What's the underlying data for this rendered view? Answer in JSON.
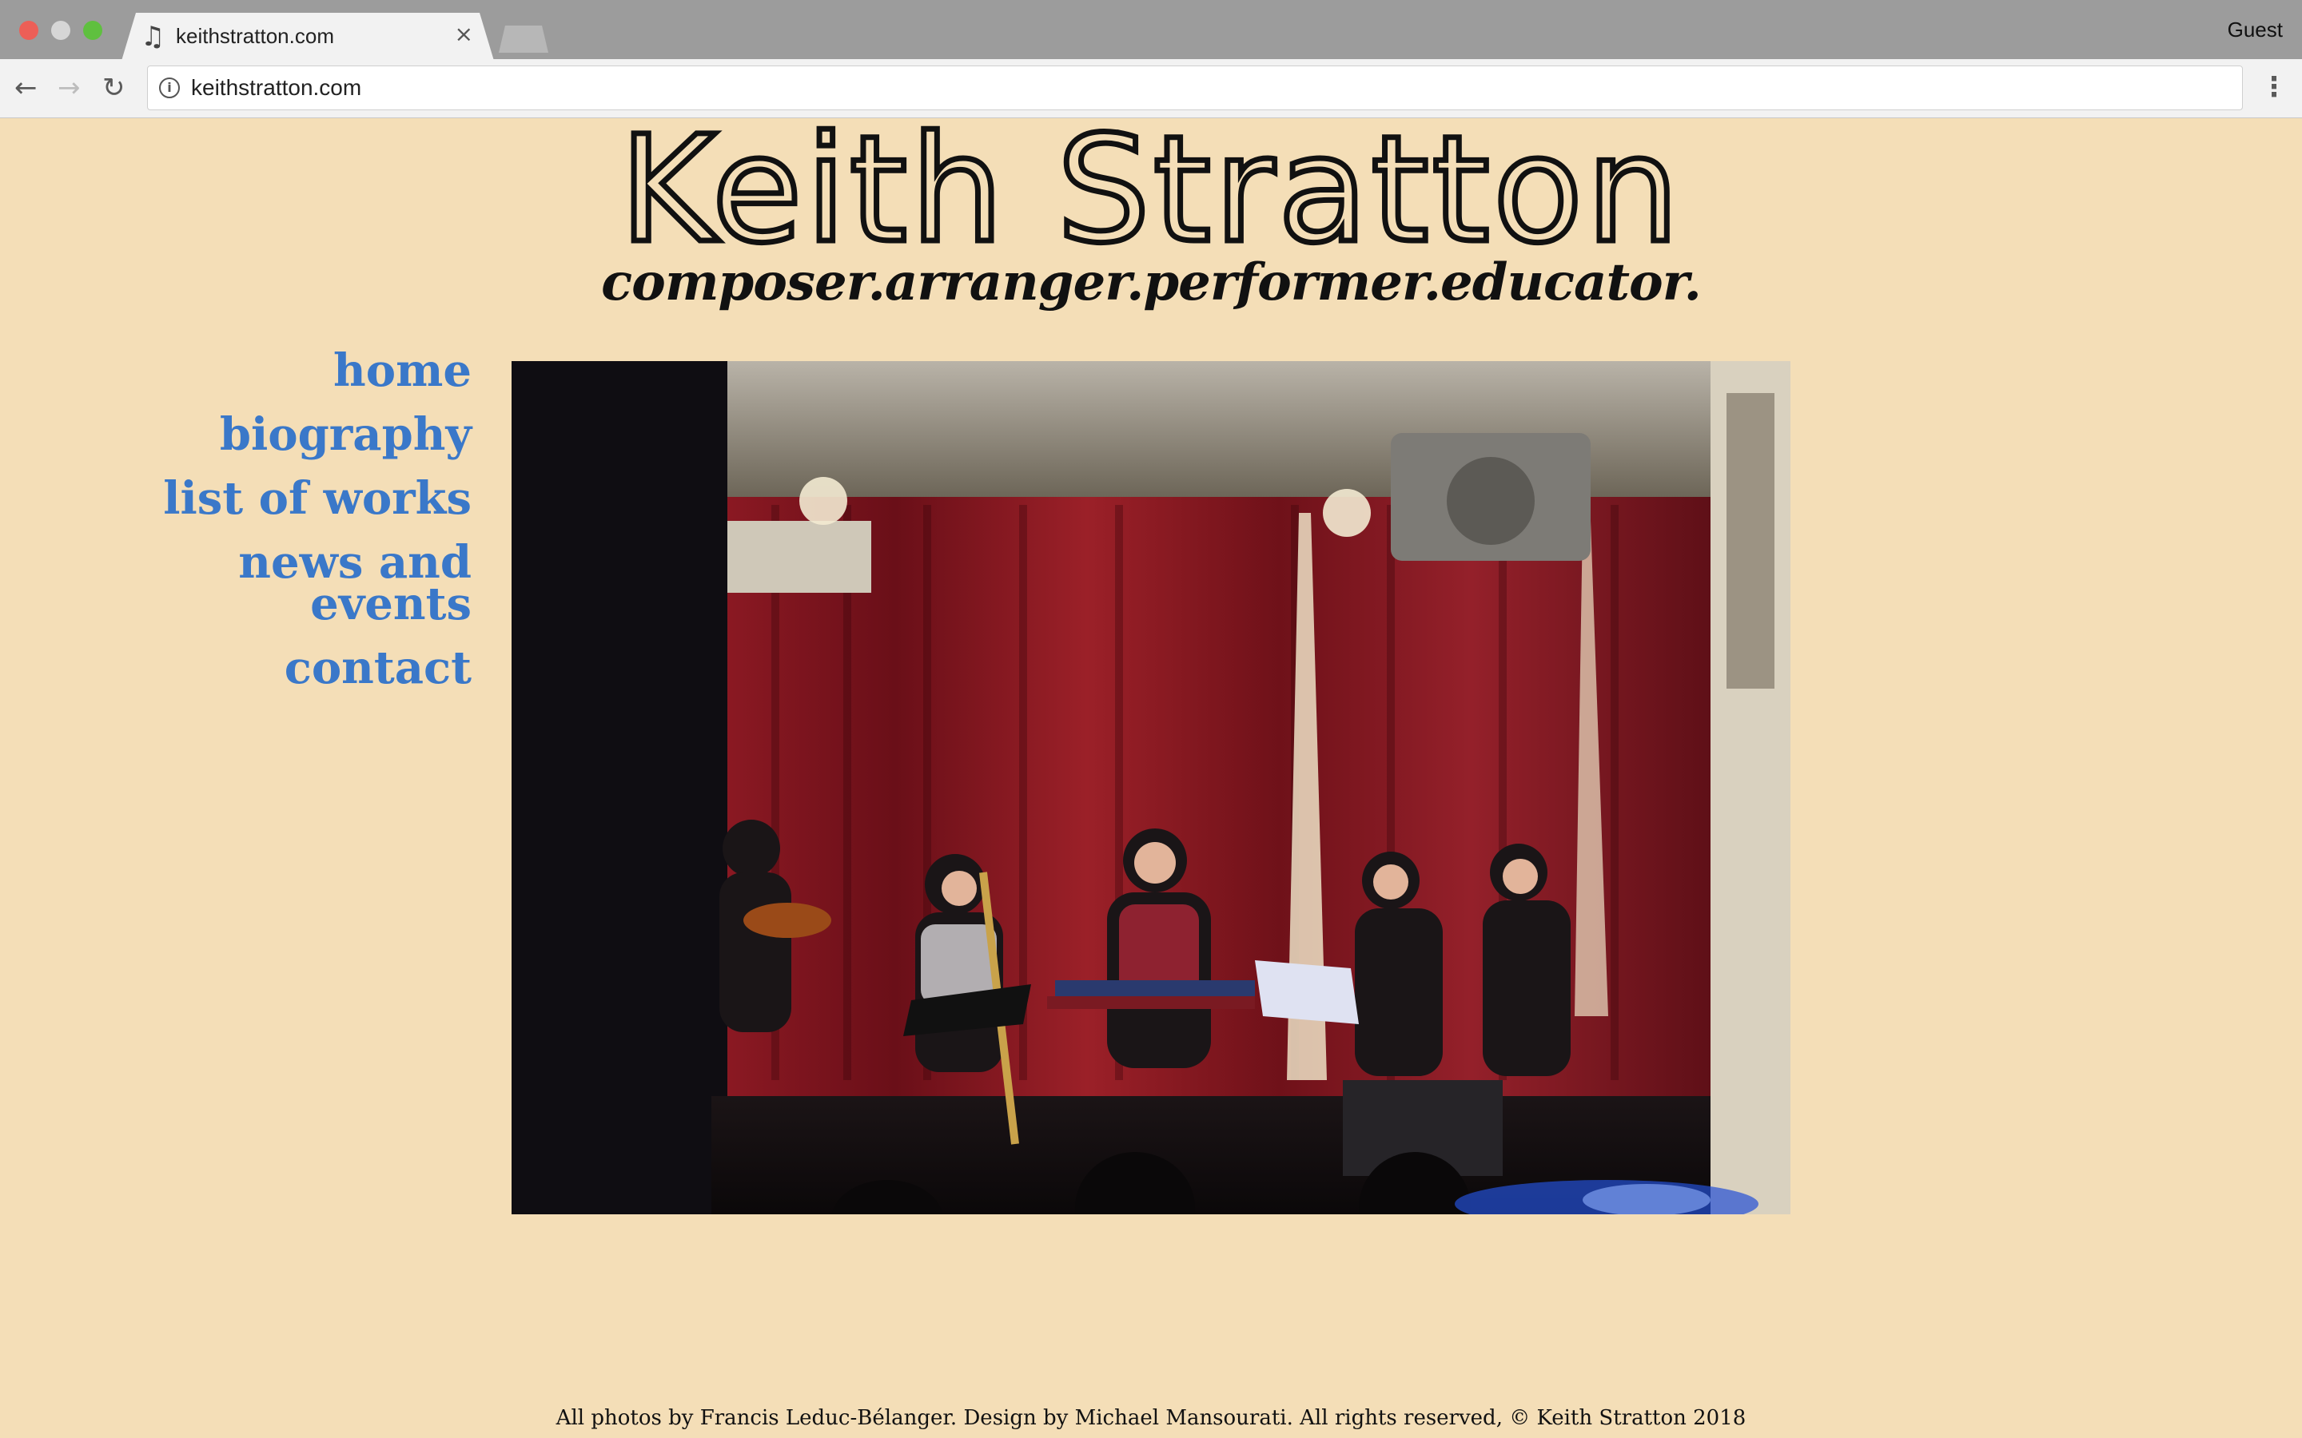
{
  "browser": {
    "tab_title": "keithstratton.com",
    "tab_icon": "music-note-icon",
    "tab_close": "×",
    "profile": "Guest",
    "url": "keithstratton.com",
    "icons": {
      "back": "arrow-left-icon",
      "forward": "arrow-right-icon",
      "reload": "reload-icon",
      "info": "info-icon",
      "menu": "vertical-dots-icon"
    }
  },
  "site": {
    "title": "Keith Stratton",
    "tagline": "composer.arranger.performer.educator."
  },
  "nav": {
    "items": [
      {
        "label": "home"
      },
      {
        "label": "biography"
      },
      {
        "label": "list of works"
      },
      {
        "label": "news and events"
      },
      {
        "label": "contact"
      }
    ]
  },
  "footer": {
    "text": "All photos by Francis Leduc-Bélanger. Design by Michael Mansourati. All rights reserved, © Keith Stratton 2018"
  },
  "colors": {
    "page_background": "#f4deb7",
    "nav_link": "#3a78c9",
    "title_outline": "#111111"
  }
}
